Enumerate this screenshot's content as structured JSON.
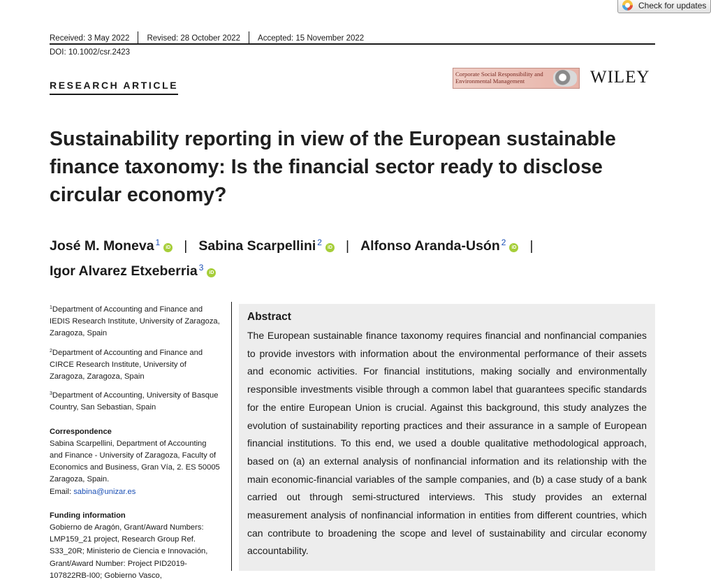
{
  "check_updates": {
    "label": "Check for updates"
  },
  "meta": {
    "received": "Received: 3 May 2022",
    "revised": "Revised: 28 October 2022",
    "accepted": "Accepted: 15 November 2022",
    "doi": "DOI: 10.1002/csr.2423"
  },
  "section_label": "RESEARCH ARTICLE",
  "journal": {
    "line1": "Corporate Social Responsibility and",
    "line2": "Environmental Management"
  },
  "publisher": "WILEY",
  "title": "Sustainability reporting in view of the European sustainable finance taxonomy: Is the financial sector ready to disclose circular economy?",
  "authors": [
    {
      "name": "José M. Moneva",
      "aff": "1"
    },
    {
      "name": "Sabina Scarpellini",
      "aff": "2"
    },
    {
      "name": "Alfonso Aranda-Usón",
      "aff": "2"
    },
    {
      "name": "Igor Alvarez Etxeberria",
      "aff": "3"
    }
  ],
  "orcid_label": "iD",
  "separator": "|",
  "affiliations": [
    {
      "num": "1",
      "text": "Department of Accounting and Finance and IEDIS Research Institute, University of Zaragoza, Zaragoza, Spain"
    },
    {
      "num": "2",
      "text": "Department of Accounting and Finance and CIRCE Research Institute, University of Zaragoza, Zaragoza, Spain"
    },
    {
      "num": "3",
      "text": "Department of Accounting, University of Basque Country, San Sebastian, Spain"
    }
  ],
  "correspondence": {
    "heading": "Correspondence",
    "text": "Sabina Scarpellini, Department of Accounting and Finance - University of Zaragoza, Faculty of Economics and Business, Gran Vía, 2. ES 50005 Zaragoza, Spain.",
    "email_label": "Email:",
    "email": "sabina@unizar.es"
  },
  "funding": {
    "heading": "Funding information",
    "text": "Gobierno de Aragón, Grant/Award Numbers: LMP159_21 project, Research Group Ref. S33_20R; Ministerio de Ciencia e Innovación, Grant/Award Number: Project PID2019-107822RB-I00; Gobierno Vasco,"
  },
  "abstract": {
    "heading": "Abstract",
    "text": "The European sustainable finance taxonomy requires financial and nonfinancial companies to provide investors with information about the environmental performance of their assets and economic activities. For financial institutions, making socially and environmentally responsible investments visible through a common label that guarantees specific standards for the entire European Union is crucial. Against this background, this study analyzes the evolution of sustainability reporting practices and their assurance in a sample of European financial institutions. To this end, we used a double qualitative methodological approach, based on (a) an external analysis of nonfinancial information and its relationship with the main economic-financial variables of the sample companies, and (b) a case study of a bank carried out through semi-structured interviews. This study provides an external measurement analysis of nonfinancial information in entities from different countries, which can contribute to broadening the scope and level of sustainability and circular economy accountability."
  }
}
